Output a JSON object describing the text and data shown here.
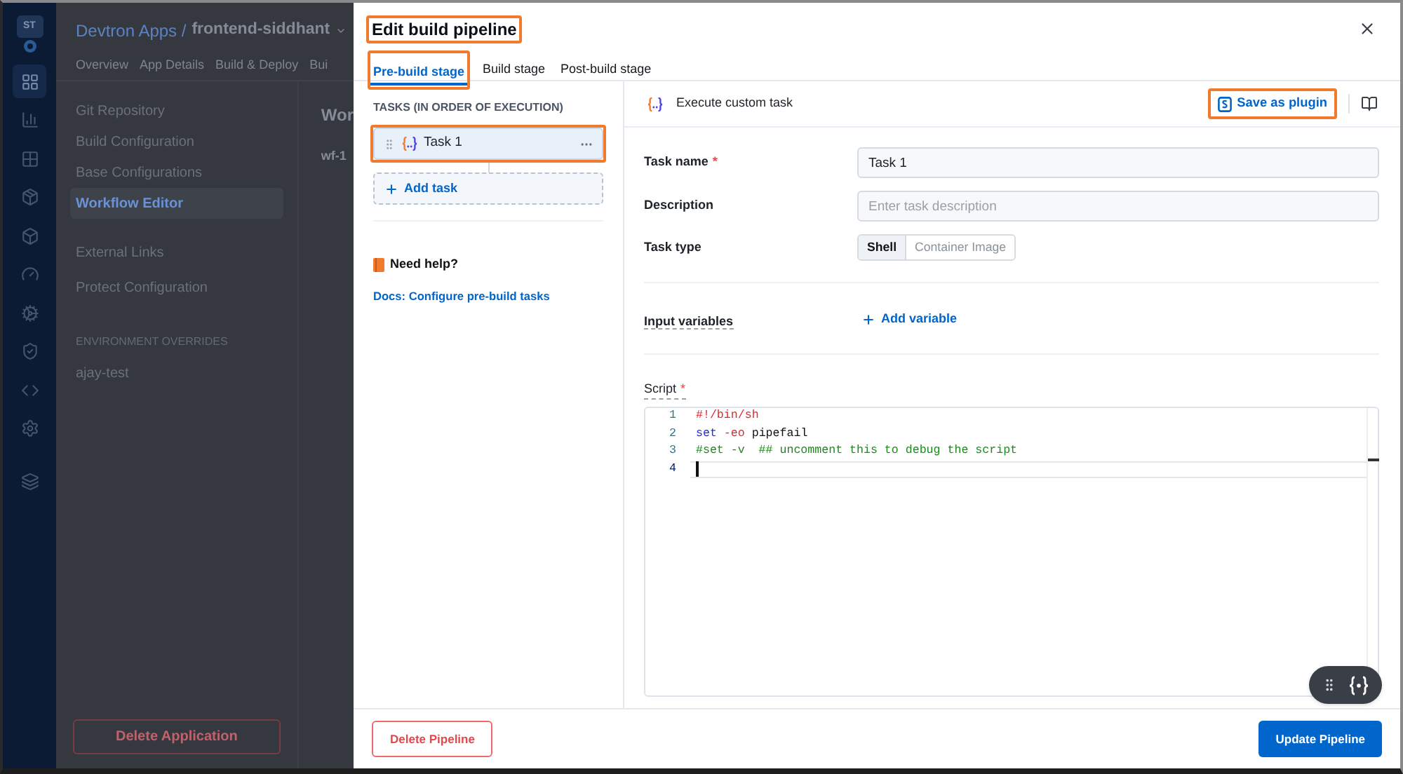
{
  "sidebar": {
    "avatar": "ST",
    "items": [
      {
        "selected": true
      },
      {
        "selected": false
      },
      {
        "selected": false
      },
      {
        "selected": false
      },
      {
        "selected": false
      },
      {
        "selected": false
      },
      {
        "selected": false
      },
      {
        "selected": false
      },
      {
        "selected": false
      },
      {
        "selected": false
      },
      {
        "selected": false
      }
    ]
  },
  "app_header": {
    "breadcrumb": "Devtron Apps /",
    "app_name": "frontend-siddhant",
    "tabs": [
      "Overview",
      "App Details",
      "Build & Deploy",
      "Bui"
    ]
  },
  "app_nav": {
    "groups": [
      {
        "items": [
          {
            "label": "Git Repository",
            "selected": false
          },
          {
            "label": "Build Configuration",
            "selected": false
          },
          {
            "label": "Base Configurations",
            "selected": false
          },
          {
            "label": "Workflow Editor",
            "selected": true
          }
        ]
      },
      {
        "items": [
          {
            "label": "External Links",
            "selected": false
          },
          {
            "label": "Protect Configuration",
            "selected": false
          }
        ]
      },
      {
        "title": "ENVIRONMENT OVERRIDES",
        "items": [
          {
            "label": "ajay-test",
            "selected": false
          }
        ]
      }
    ],
    "delete_button": "Delete Application"
  },
  "app_content": {
    "heading": "Wor",
    "workflow_name": "wf-1"
  },
  "modal": {
    "title": {
      "text": "Edit build pipeline",
      "highlighted": true
    },
    "tabs": [
      {
        "label": "Pre-build stage",
        "selected": true,
        "highlighted": true
      },
      {
        "label": "Build stage",
        "selected": false,
        "highlighted": false
      },
      {
        "label": "Post-build stage",
        "selected": false,
        "highlighted": false
      }
    ],
    "tasks_panel": {
      "heading": "TASKS (IN ORDER OF EXECUTION)",
      "tasks": [
        {
          "name": "Task 1",
          "selected": true,
          "highlighted": true
        }
      ],
      "add_task": "Add task",
      "help_title": "Need help?",
      "docs_link": "Docs: Configure pre-build tasks"
    },
    "task_editor": {
      "header": "Execute custom task",
      "save_plugin": {
        "label": "Save as plugin",
        "highlighted": true
      },
      "fields": [
        {
          "kind": "text",
          "label": "Task name",
          "required_mark": "*",
          "value": "Task 1"
        },
        {
          "kind": "text",
          "label": "Description",
          "placeholder": "Enter task description"
        },
        {
          "kind": "segmented",
          "label": "Task type",
          "options": [
            {
              "label": "Shell",
              "selected": true
            },
            {
              "label": "Container Image",
              "selected": false
            }
          ]
        }
      ],
      "input_variables": {
        "label": "Input variables",
        "add": "Add variable"
      },
      "script": {
        "label": "Script",
        "required_mark": "*",
        "lines": [
          {
            "number": "1",
            "current": false,
            "tokens": [
              {
                "kind": "shebang",
                "text": "#!/bin/sh"
              }
            ]
          },
          {
            "number": "2",
            "current": false,
            "tokens": [
              {
                "kind": "keyword",
                "text": "set"
              },
              {
                "kind": "flag",
                "text": " -eo"
              },
              {
                "kind": "plain",
                "text": " pipefail"
              }
            ]
          },
          {
            "number": "3",
            "current": false,
            "tokens": [
              {
                "kind": "comment",
                "text": "#set -v  ## uncomment this to debug the script"
              }
            ]
          },
          {
            "number": "4",
            "current": true
          }
        ]
      }
    },
    "footer": {
      "delete": "Delete Pipeline",
      "update": "Update Pipeline"
    }
  }
}
